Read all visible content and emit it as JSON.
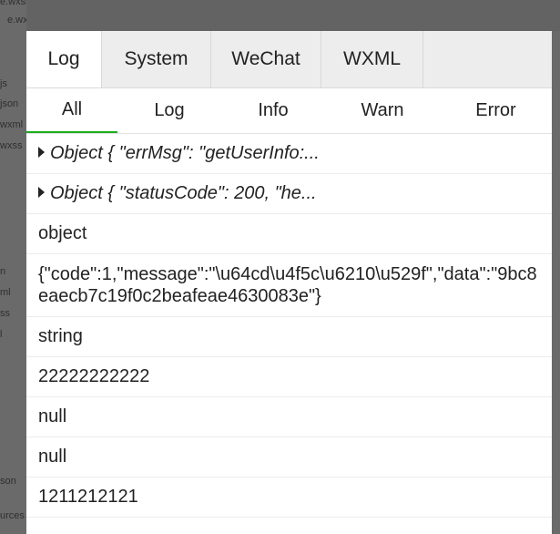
{
  "background": {
    "files": [
      "e.wxss",
      "e.wxs",
      "js",
      "json",
      "wxml",
      "wxss",
      "n",
      "ml",
      "ss",
      "l",
      "son",
      "urces"
    ]
  },
  "tabs": [
    {
      "label": "Log",
      "active": true
    },
    {
      "label": "System",
      "active": false
    },
    {
      "label": "WeChat",
      "active": false
    },
    {
      "label": "WXML",
      "active": false
    }
  ],
  "subtabs": [
    {
      "label": "All",
      "active": true
    },
    {
      "label": "Log",
      "active": false
    },
    {
      "label": "Info",
      "active": false
    },
    {
      "label": "Warn",
      "active": false
    },
    {
      "label": "Error",
      "active": false
    }
  ],
  "logs": [
    {
      "text": "Object { \"errMsg\": \"getUserInfo:...",
      "type": "object"
    },
    {
      "text": "Object { \"statusCode\": 200, \"he...",
      "type": "object"
    },
    {
      "text": "object",
      "type": "plain"
    },
    {
      "text": "{\"code\":1,\"message\":\"\\u64cd\\u4f5c\\u6210\\u529f\",\"data\":\"9bc8eaecb7c19f0c2beafeae4630083e\"}",
      "type": "plain"
    },
    {
      "text": "string",
      "type": "plain"
    },
    {
      "text": "22222222222",
      "type": "plain"
    },
    {
      "text": "null",
      "type": "plain"
    },
    {
      "text": "null",
      "type": "plain"
    },
    {
      "text": "1211212121",
      "type": "plain"
    }
  ],
  "colors": {
    "active_underline": "#1aad19",
    "overlay": "#5f5f5f"
  }
}
